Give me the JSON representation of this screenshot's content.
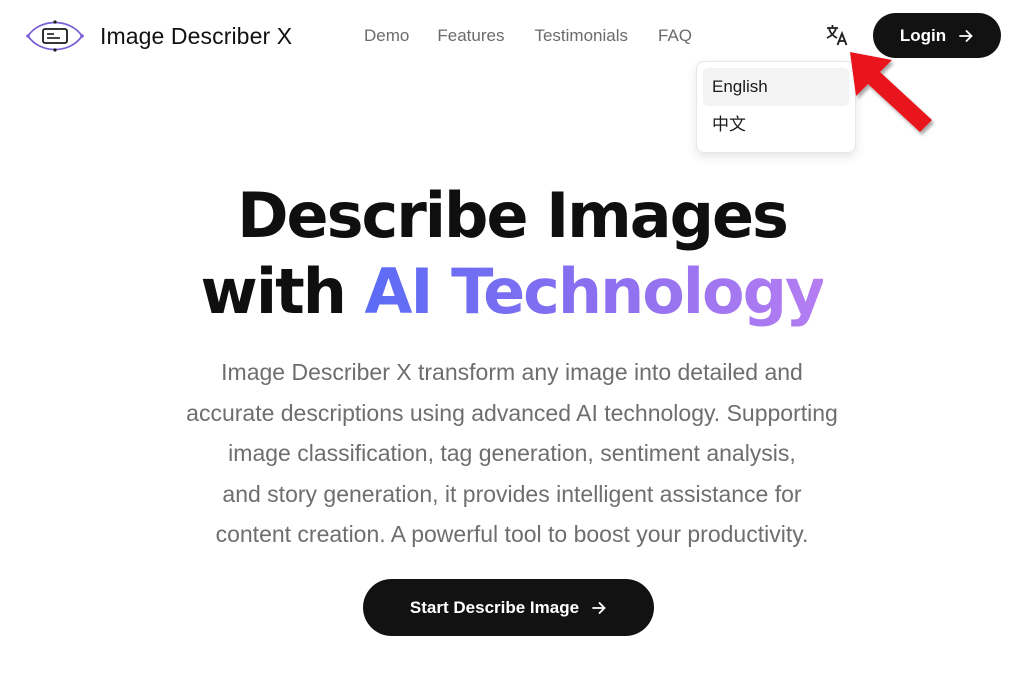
{
  "header": {
    "brand_name": "Image Describer X",
    "logo_icon": "eye-screen-logo-icon",
    "nav": [
      {
        "label": "Demo"
      },
      {
        "label": "Features"
      },
      {
        "label": "Testimonials"
      },
      {
        "label": "FAQ"
      }
    ],
    "language_icon": "translate-icon",
    "login_label": "Login",
    "login_icon": "arrow-right-icon"
  },
  "language_menu": {
    "items": [
      {
        "label": "English",
        "active": true
      },
      {
        "label": "中文",
        "active": false
      }
    ]
  },
  "annotation": {
    "icon": "red-arrow-pointer-icon",
    "color": "#e8131b"
  },
  "hero": {
    "title_line1": "Describe Images",
    "title_line2_prefix": "with ",
    "title_line2_highlight": "AI Technology",
    "description_lines": [
      "Image Describer X transform any image into detailed and",
      "accurate descriptions using advanced AI technology. Supporting",
      "image classification, tag generation, sentiment analysis,",
      "and story generation, it provides intelligent assistance for",
      "content creation. A powerful tool to boost your productivity."
    ],
    "cta_label": "Start Describe Image",
    "cta_icon": "arrow-right-icon"
  },
  "colors": {
    "primary_dark": "#121212",
    "gradient_start": "#5b6cf5",
    "gradient_end": "#b57df2",
    "muted_text": "#6e6e6e",
    "logo_purple": "#7a5fd6"
  }
}
